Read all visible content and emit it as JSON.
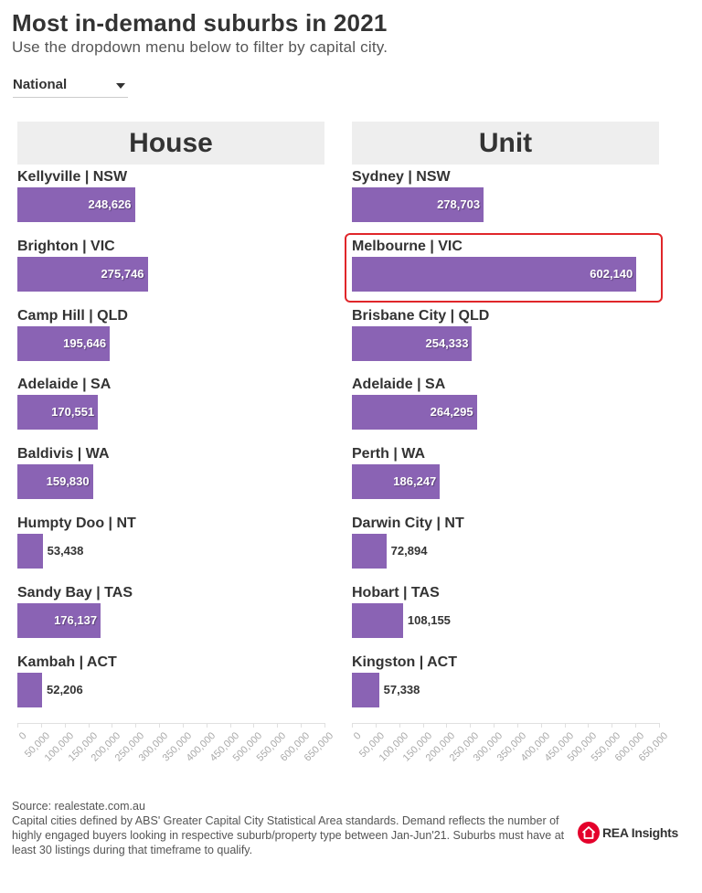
{
  "title": "Most in-demand suburbs in 2021",
  "subtitle": "Use the dropdown menu below to filter by capital city.",
  "dropdown": {
    "selected": "National",
    "icon": "caret-down-icon"
  },
  "colors": {
    "bar": "#8a63b4",
    "highlight": "#e0262a",
    "header_bg": "#eeeeee",
    "logo": "#e4002b"
  },
  "chart_data": [
    {
      "type": "bar",
      "orientation": "horizontal",
      "title": "House",
      "categories": [
        "Kellyville | NSW",
        "Brighton | VIC",
        "Camp Hill | QLD",
        "Adelaide | SA",
        "Baldivis | WA",
        "Humpty Doo | NT",
        "Sandy Bay | TAS",
        "Kambah | ACT"
      ],
      "values": [
        248626,
        275746,
        195646,
        170551,
        159830,
        53438,
        176137,
        52206
      ],
      "value_labels": [
        "248,626",
        "275,746",
        "195,646",
        "170,551",
        "159,830",
        "53,438",
        "176,137",
        "52,206"
      ],
      "xlim": [
        0,
        650000
      ],
      "xticks": [
        "0",
        "50,000",
        "100,000",
        "150,000",
        "200,000",
        "250,000",
        "300,000",
        "350,000",
        "400,000",
        "450,000",
        "500,000",
        "550,000",
        "600,000",
        "650,000"
      ],
      "xlabel": "",
      "ylabel": "",
      "grid": false
    },
    {
      "type": "bar",
      "orientation": "horizontal",
      "title": "Unit",
      "categories": [
        "Sydney | NSW",
        "Melbourne | VIC",
        "Brisbane City | QLD",
        "Adelaide | SA",
        "Perth | WA",
        "Darwin City | NT",
        "Hobart | TAS",
        "Kingston | ACT"
      ],
      "values": [
        278703,
        602140,
        254333,
        264295,
        186247,
        72894,
        108155,
        57338
      ],
      "value_labels": [
        "278,703",
        "602,140",
        "254,333",
        "264,295",
        "186,247",
        "72,894",
        "108,155",
        "57,338"
      ],
      "xlim": [
        0,
        650000
      ],
      "xticks": [
        "0",
        "50,000",
        "100,000",
        "150,000",
        "200,000",
        "250,000",
        "300,000",
        "350,000",
        "400,000",
        "450,000",
        "500,000",
        "550,000",
        "600,000",
        "650,000"
      ],
      "xlabel": "",
      "ylabel": "",
      "grid": false,
      "highlighted_category": "Melbourne | VIC"
    }
  ],
  "footer": {
    "source": "Source: realestate.com.au",
    "note": "Capital cities defined by ABS' Greater Capital City Statistical Area standards. Demand reflects the number of highly engaged buyers looking in respective suburb/property type between Jan-Jun'21. Suburbs must have at least 30 listings during that timeframe to qualify."
  },
  "logo": {
    "text": "REA Insights",
    "icon": "rea-house-logo-icon"
  }
}
